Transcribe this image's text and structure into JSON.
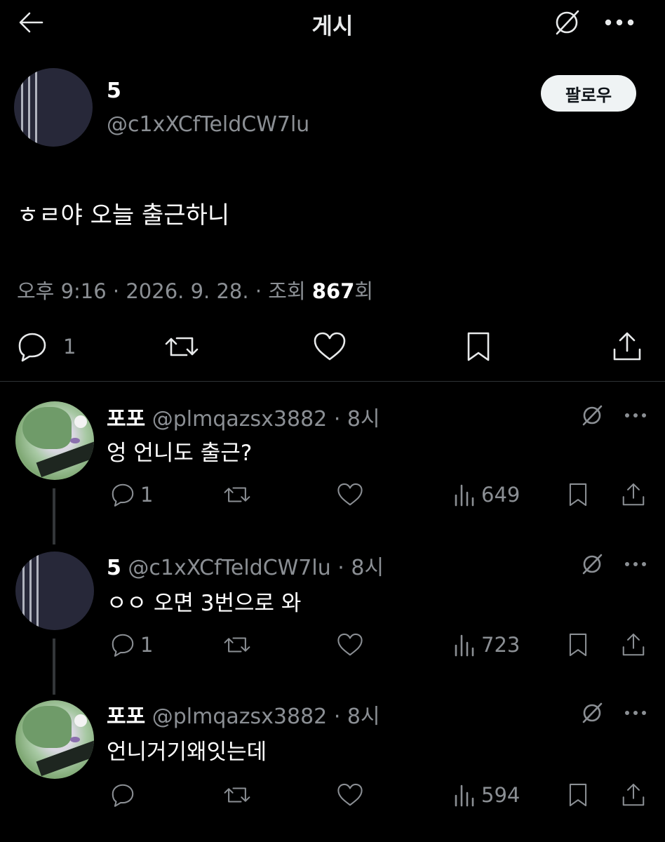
{
  "header": {
    "title": "게시",
    "icons": [
      "back-arrow-icon",
      "grok-icon",
      "more-icon"
    ]
  },
  "post": {
    "author_name": "5",
    "author_handle": "@c1xXCfTeldCW7lu",
    "follow_label": "팔로우",
    "text": "ㅎㄹ야 오늘 출근하니",
    "time": "오후 9:16",
    "sep1": " · ",
    "date": "2026. 9. 28.",
    "sep2": " · ",
    "views_label": "조회 ",
    "views_count": "867",
    "views_suffix": "회",
    "reply_count": "1"
  },
  "replies": [
    {
      "name": "포포",
      "handle": "@plmqazsx3882",
      "time": "· 8시",
      "text": "엉 언니도 출근?",
      "reply_count": "1",
      "views": "649"
    },
    {
      "name": "5",
      "handle": "@c1xXCfTeldCW7lu",
      "time": "· 8시",
      "text": "ㅇㅇ 오면 3번으로 와",
      "reply_count": "1",
      "views": "723"
    },
    {
      "name": "포포",
      "handle": "@plmqazsx3882",
      "time": "· 8시",
      "text": "언니거기왜잇는데",
      "reply_count": "",
      "views": "594"
    }
  ],
  "colors": {
    "background": "#000000",
    "text": "#e7e9ea",
    "secondary": "#8b8f94",
    "follow_bg": "#eff3f4"
  }
}
